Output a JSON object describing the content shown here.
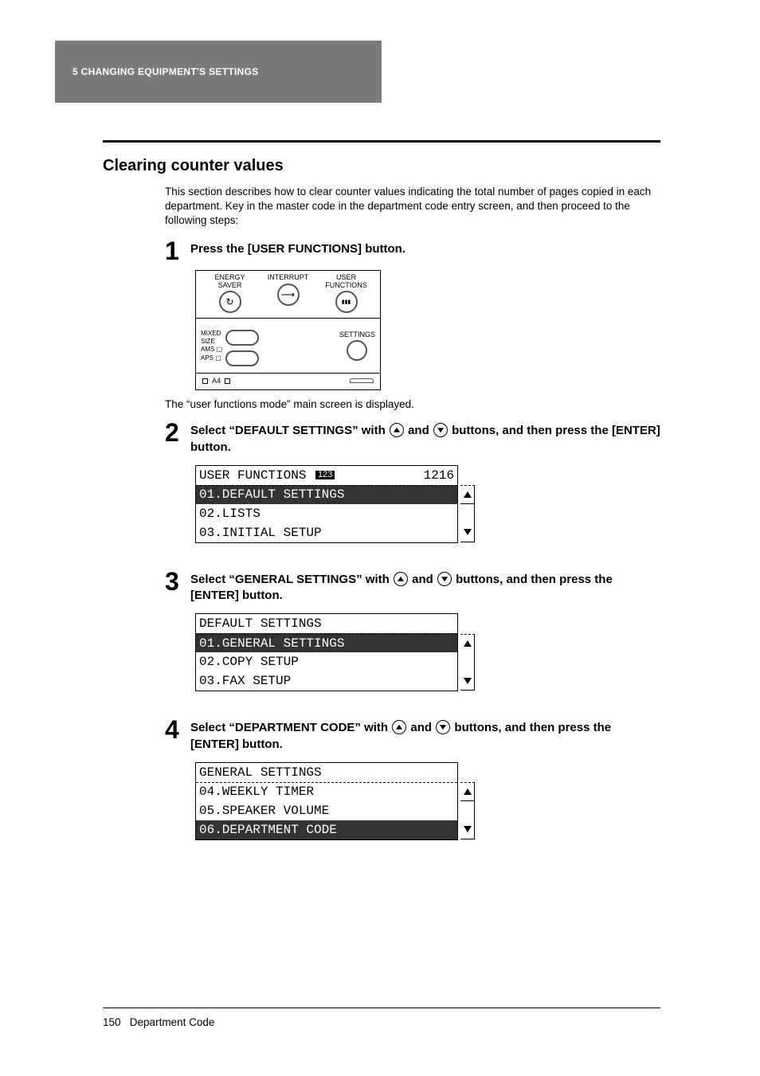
{
  "header": {
    "chapter": "5   CHANGING EQUIPMENT'S SETTINGS"
  },
  "title": "Clearing counter values",
  "intro": "This section describes how to clear counter values indicating the total number of pages copied in each department. Key in the master code in the department code entry screen, and then proceed to the following steps:",
  "steps": {
    "s1": {
      "num": "1",
      "title": "Press the [USER FUNCTIONS] button.",
      "note": "The “user functions mode” main screen is displayed.",
      "panel": {
        "btn1": "ENERGY\nSAVER",
        "btn2": "INTERRUPT",
        "btn3": "USER\nFUNCTIONS",
        "mixed": "MIXED\nSIZE",
        "ams": "AMS",
        "aps": "APS",
        "settings": "SETTINGS",
        "a4": "A4"
      }
    },
    "s2": {
      "num": "2",
      "title_a": "Select “DEFAULT SETTINGS” with ",
      "title_b": " and ",
      "title_c": " buttons, and then press the [ENTER] button.",
      "lcd": {
        "r0a": "USER FUNCTIONS",
        "r0num": "123",
        "r0b": "1216",
        "r1": "01.DEFAULT SETTINGS",
        "r2": "02.LISTS",
        "r3": "03.INITIAL SETUP"
      }
    },
    "s3": {
      "num": "3",
      "title_a": "Select “GENERAL SETTINGS” with ",
      "title_b": " and ",
      "title_c": " buttons, and then press the [ENTER] button.",
      "lcd": {
        "r0": "DEFAULT SETTINGS",
        "r1": "01.GENERAL SETTINGS",
        "r2": "02.COPY SETUP",
        "r3": "03.FAX SETUP"
      }
    },
    "s4": {
      "num": "4",
      "title_a": "Select “DEPARTMENT CODE” with ",
      "title_b": " and ",
      "title_c": " buttons, and then press the [ENTER] button.",
      "lcd": {
        "r0": "GENERAL SETTINGS",
        "r1": "04.WEEKLY TIMER",
        "r2": "05.SPEAKER VOLUME",
        "r3": "06.DEPARTMENT CODE"
      }
    }
  },
  "footer": {
    "page": "150",
    "section": "Department Code"
  }
}
